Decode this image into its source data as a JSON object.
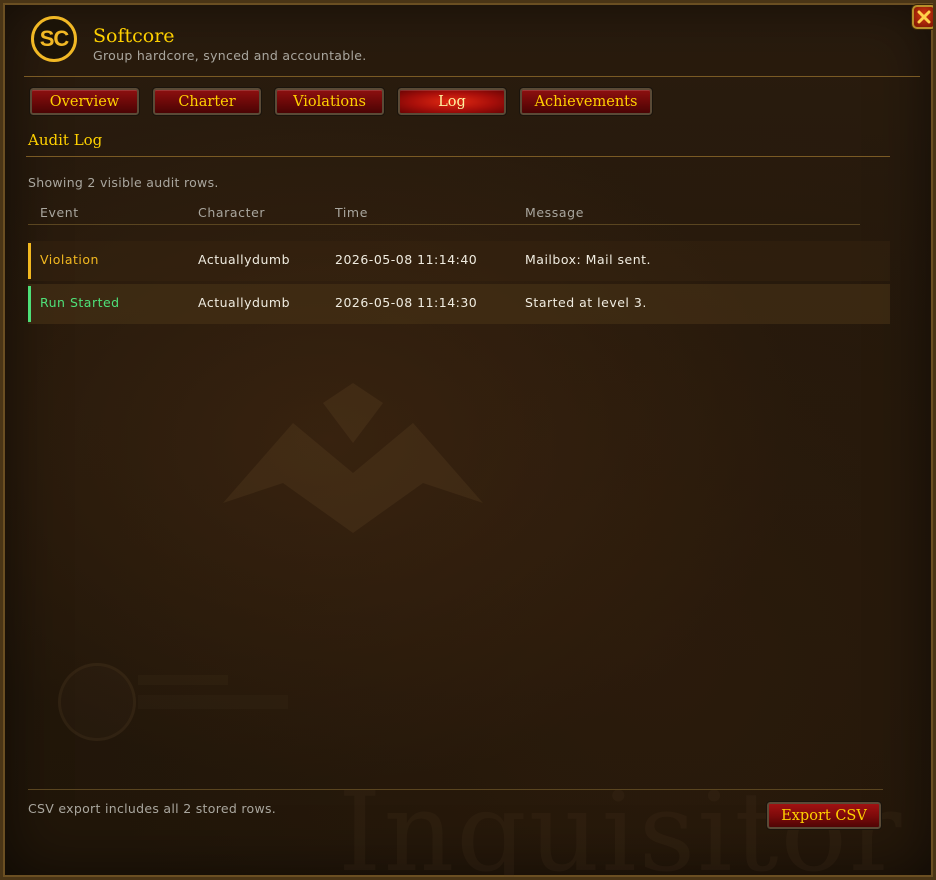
{
  "window": {
    "logo_text": "SC",
    "title": "Softcore",
    "subtitle": "Group hardcore, synced and accountable.",
    "close_icon": "close-icon"
  },
  "tabs": [
    {
      "label": "Overview",
      "active": false
    },
    {
      "label": "Charter",
      "active": false
    },
    {
      "label": "Violations",
      "active": false
    },
    {
      "label": "Log",
      "active": true
    },
    {
      "label": "Achievements",
      "active": false
    }
  ],
  "log": {
    "title": "Audit Log",
    "status": "Showing 2 visible audit rows.",
    "columns": [
      "Event",
      "Character",
      "Time",
      "Message"
    ],
    "rows": [
      {
        "event": "Violation",
        "character": "Actuallydumb",
        "time": "2026-05-08 11:14:40",
        "message": "Mailbox: Mail sent.",
        "color": "#f2b820"
      },
      {
        "event": "Run Started",
        "character": "Actuallydumb",
        "time": "2026-05-08 11:14:30",
        "message": "Started at level 3.",
        "color": "#4ee078"
      }
    ]
  },
  "footer": {
    "note": "CSV export includes all 2 stored rows.",
    "export_label": "Export CSV"
  },
  "background": {
    "watermark": "Inquisitor"
  },
  "colors": {
    "gold": "#ffd100",
    "muted_text": "#a9a69e",
    "violation": "#f2b820",
    "run_started": "#4ee078"
  }
}
